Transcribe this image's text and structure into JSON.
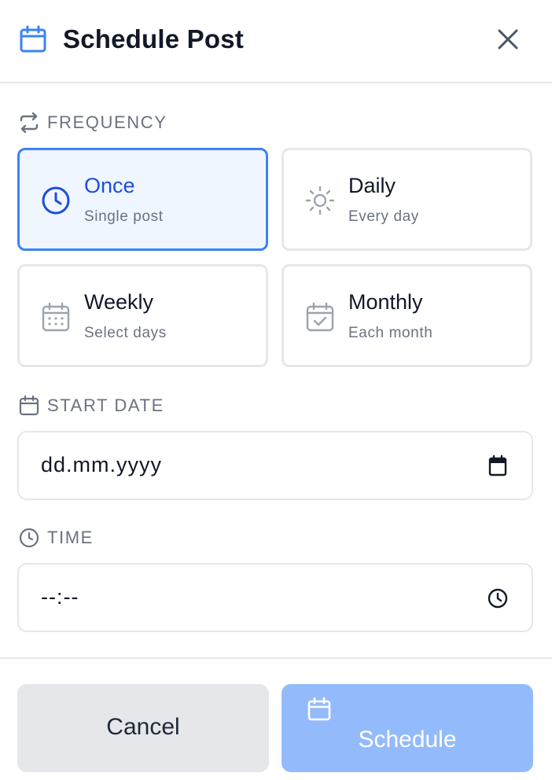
{
  "header": {
    "title": "Schedule Post",
    "icon": "calendar-icon",
    "close_icon": "close-icon"
  },
  "frequency": {
    "label": "FREQUENCY",
    "icon": "repeat-icon",
    "options": [
      {
        "title": "Once",
        "subtitle": "Single post",
        "icon": "clock-icon",
        "selected": true
      },
      {
        "title": "Daily",
        "subtitle": "Every day",
        "icon": "sun-icon",
        "selected": false
      },
      {
        "title": "Weekly",
        "subtitle": "Select days",
        "icon": "calendar-grid-icon",
        "selected": false
      },
      {
        "title": "Monthly",
        "subtitle": "Each month",
        "icon": "calendar-check-icon",
        "selected": false
      }
    ]
  },
  "start_date": {
    "label": "START DATE",
    "icon": "calendar-icon",
    "placeholder": "dd.mm.yyyy",
    "picker_icon": "calendar-icon"
  },
  "time": {
    "label": "TIME",
    "icon": "clock-icon",
    "placeholder": "--:--",
    "picker_icon": "clock-icon"
  },
  "actions": {
    "cancel_label": "Cancel",
    "schedule_label": "Schedule",
    "schedule_icon": "calendar-icon"
  },
  "colors": {
    "accent": "#3b82f6",
    "selected_bg": "#eff6ff",
    "schedule_disabled_bg": "#93bbfb",
    "cancel_bg": "#e5e7eb"
  }
}
